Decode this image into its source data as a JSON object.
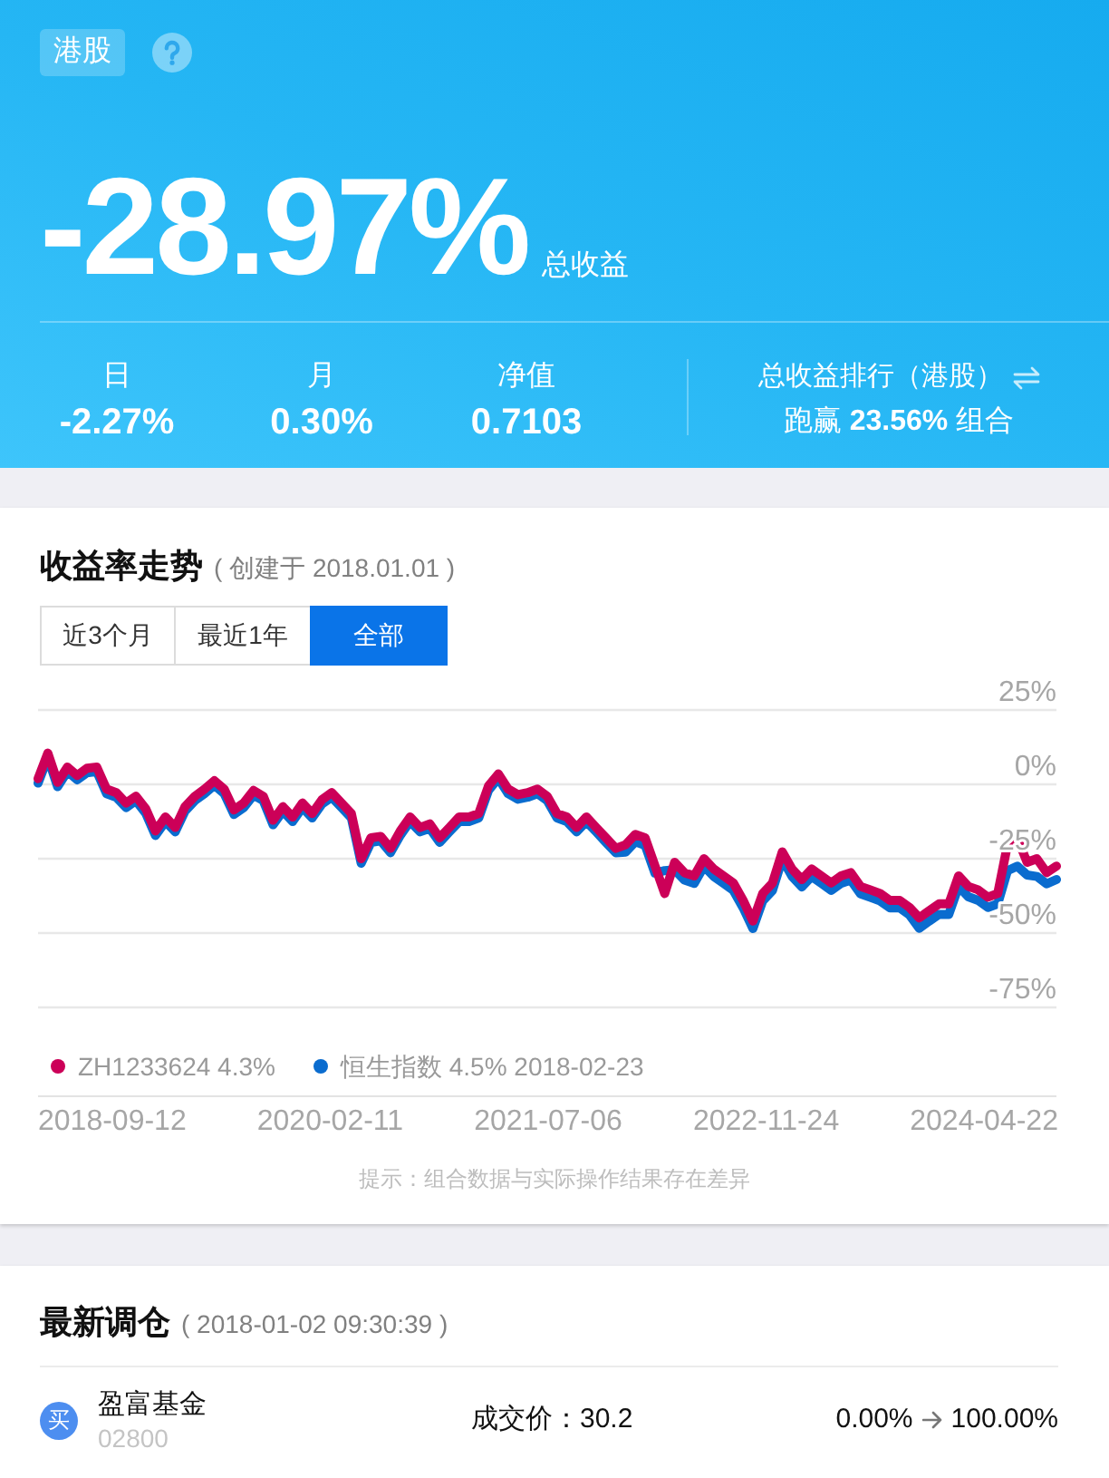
{
  "header": {
    "market_tag": "港股",
    "total_return": "-28.97%",
    "total_return_label": "总收益",
    "stats": [
      {
        "label": "日",
        "value": "-2.27%"
      },
      {
        "label": "月",
        "value": "0.30%"
      },
      {
        "label": "净值",
        "value": "0.7103"
      }
    ],
    "ranking": {
      "title": "总收益排行（港股）",
      "text": "跑赢 **23.56%** 组合"
    }
  },
  "trend": {
    "title": "收益率走势",
    "subtitle": "( 创建于 2018.01.01 )",
    "tabs": [
      {
        "label": "近3个月",
        "selected": false
      },
      {
        "label": "最近1年",
        "selected": false
      },
      {
        "label": "全部",
        "selected": true
      }
    ],
    "chart_data": {
      "type": "line",
      "grid": true,
      "ylim": [
        -75,
        25
      ],
      "yticks": [
        {
          "value": 25,
          "label": "25%"
        },
        {
          "value": 0,
          "label": "0%"
        },
        {
          "value": -25,
          "label": "-25%"
        },
        {
          "value": -50,
          "label": "-50%"
        },
        {
          "value": -75,
          "label": "-75%"
        }
      ],
      "series": [
        {
          "name": "ZH1233624",
          "color": "#cc0058",
          "values": [
            1.9,
            10.5,
            0.7,
            5.8,
            3.0,
            5.4,
            5.8,
            -1.6,
            -2.8,
            -6.3,
            -4.0,
            -8.2,
            -15.7,
            -11.0,
            -14.5,
            -7.5,
            -4.0,
            -1.6,
            1.2,
            -1.6,
            -8.6,
            -6.3,
            -2.1,
            -4.0,
            -12.1,
            -7.5,
            -11.0,
            -6.3,
            -9.8,
            -5.1,
            -2.8,
            -6.3,
            -9.8,
            -25.0,
            -18.0,
            -17.5,
            -21.5,
            -15.7,
            -11.0,
            -14.5,
            -13.3,
            -18.0,
            -14.5,
            -11.0,
            -11.0,
            -9.8,
            -0.5,
            3.5,
            -1.6,
            -3.5,
            -2.8,
            -1.6,
            -4.0,
            -9.8,
            -11.0,
            -14.5,
            -11.0,
            -14.5,
            -18.0,
            -21.5,
            -20.3,
            -16.8,
            -18.0,
            -27.3,
            -36.7,
            -26.2,
            -29.7,
            -30.8,
            -25.0,
            -28.5,
            -30.8,
            -33.2,
            -39.0,
            -46.0,
            -36.7,
            -33.2,
            -22.7,
            -28.5,
            -32.0,
            -28.5,
            -30.8,
            -33.2,
            -30.8,
            -29.7,
            -34.3,
            -35.5,
            -36.7,
            -39.0,
            -39.0,
            -41.4,
            -44.9,
            -42.5,
            -40.2,
            -40.2,
            -30.8,
            -34.3,
            -35.5,
            -37.9,
            -36.7,
            -20.3,
            -18.0,
            -26.2,
            -25.0,
            -29.7,
            -27.5
          ]
        },
        {
          "name": "恒生指数",
          "color": "#0a6ccf",
          "values": [
            0.4,
            9.0,
            -0.8,
            4.3,
            1.5,
            3.9,
            4.3,
            -3.1,
            -4.3,
            -7.8,
            -5.5,
            -9.7,
            -17.2,
            -12.5,
            -16.0,
            -9.0,
            -5.5,
            -3.1,
            -0.3,
            -3.1,
            -10.1,
            -7.8,
            -3.6,
            -5.5,
            -13.6,
            -9.0,
            -12.5,
            -7.8,
            -11.3,
            -6.6,
            -4.3,
            -7.8,
            -11.3,
            -26.5,
            -19.5,
            -19.0,
            -23.0,
            -17.2,
            -12.5,
            -16.0,
            -14.8,
            -19.5,
            -16.0,
            -12.5,
            -12.5,
            -11.3,
            -2.0,
            2.0,
            -3.1,
            -5.0,
            -4.3,
            -3.1,
            -5.5,
            -11.3,
            -12.5,
            -16.0,
            -12.5,
            -16.0,
            -19.5,
            -23.0,
            -22.8,
            -19.3,
            -20.5,
            -29.8,
            -29.0,
            -28.7,
            -32.2,
            -33.3,
            -27.5,
            -31.0,
            -33.3,
            -35.7,
            -41.5,
            -48.5,
            -39.2,
            -35.7,
            -25.2,
            -31.0,
            -34.5,
            -31.0,
            -33.3,
            -35.7,
            -33.3,
            -32.2,
            -36.8,
            -38.0,
            -39.2,
            -41.5,
            -41.5,
            -43.9,
            -48.4,
            -46.0,
            -43.7,
            -43.7,
            -34.3,
            -37.8,
            -39.0,
            -41.4,
            -40.2,
            -29.0,
            -27.5,
            -30.5,
            -31.0,
            -33.5,
            -32.0
          ]
        }
      ]
    },
    "legend": [
      {
        "readout": "4.3%"
      },
      {
        "readout": "4.5% 2018-02-23"
      }
    ],
    "x_axis_labels": [
      "2018-09-12",
      "2020-02-11",
      "2021-07-06",
      "2022-11-24",
      "2024-04-22"
    ],
    "note": "提示：组合数据与实际操作结果存在差异"
  },
  "rebalance": {
    "title": "最新调仓",
    "subtitle": "( 2018-01-02 09:30:39 )",
    "trades": [
      {
        "action": "买",
        "name": "盈富基金",
        "code": "02800",
        "price": "成交价：30.2",
        "weight_from": "0.00%",
        "weight_to": "100.00%"
      }
    ]
  }
}
